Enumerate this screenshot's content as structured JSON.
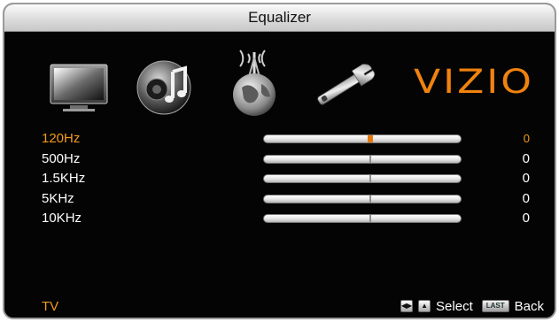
{
  "title": "Equalizer",
  "brand": "VIZIO",
  "icons": [
    "tv-icon",
    "audio-icon",
    "network-icon",
    "settings-wrench-icon"
  ],
  "colors": {
    "accent": "#f49a1c",
    "background": "#040404",
    "text": "#ffffff"
  },
  "bands": [
    {
      "label": "120Hz",
      "value": "0",
      "level": 0.5,
      "selected": true
    },
    {
      "label": "500Hz",
      "value": "0",
      "level": 0.5,
      "selected": false
    },
    {
      "label": "1.5KHz",
      "value": "0",
      "level": 0.5,
      "selected": false
    },
    {
      "label": "5KHz",
      "value": "0",
      "level": 0.5,
      "selected": false
    },
    {
      "label": "10KHz",
      "value": "0",
      "level": 0.5,
      "selected": false
    }
  ],
  "footer": {
    "input": "TV",
    "select_label": "Select",
    "last_key": "LAST",
    "back_label": "Back"
  }
}
